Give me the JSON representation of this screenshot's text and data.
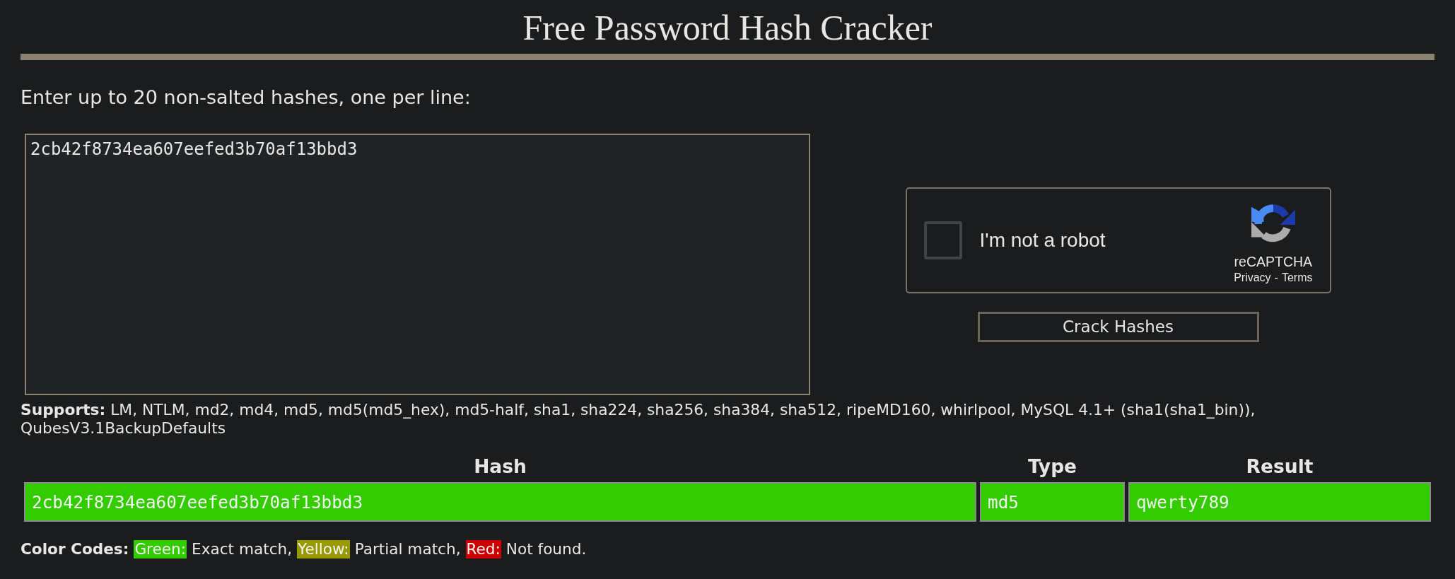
{
  "page": {
    "title": "Free Password Hash Cracker"
  },
  "form": {
    "label": "Enter up to 20 non-salted hashes, one per line:",
    "hashes_field": {
      "value": "2cb42f8734ea607eefed3b70af13bbd3"
    },
    "captcha": {
      "label": "I'm not a robot",
      "checked": false,
      "brand": "reCAPTCHA",
      "links": [
        "Privacy",
        "Terms"
      ],
      "separator": "-"
    },
    "submit_button": "Crack Hashes"
  },
  "supports": {
    "text": "**Supports:** LM, NTLM, md2, md4, md5, md5(md5_hex), md5-half, sha1, sha224, sha256, sha384, sha512, ripeMD160, whirlpool, MySQL 4.1+ (sha1(sha1_bin)), QubesV3.1BackupDefaults"
  },
  "results": {
    "columns": [
      "Hash",
      "Type",
      "Result"
    ],
    "rows": [
      {
        "color": "#33cc00",
        "cells": [
          "2cb42f8734ea607eefed3b70af13bbd3",
          "md5",
          "qwerty789"
        ]
      }
    ]
  },
  "legend": {
    "label": "Color Codes:",
    "items": [
      {
        "label": "Green:",
        "text": "Exact match,",
        "color": "#33cc00"
      },
      {
        "label": "Yellow:",
        "text": "Partial match,",
        "color": "#999900"
      },
      {
        "label": "Red:",
        "text": "Not found.",
        "color": "#cc0000"
      }
    ]
  }
}
